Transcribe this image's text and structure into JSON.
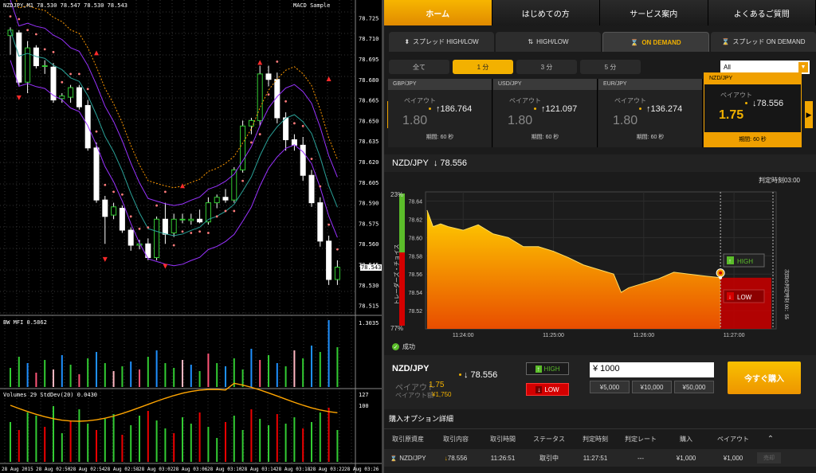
{
  "mt4": {
    "title": "NZDJPY,M1  78.530 78.547 78.530 78.543",
    "indicator_label": "MACD Sample",
    "current_price_tag": "78.543",
    "price_axis": [
      "78.725",
      "78.710",
      "78.695",
      "78.680",
      "78.665",
      "78.650",
      "78.635",
      "78.620",
      "78.605",
      "78.590",
      "78.575",
      "78.560",
      "78.545",
      "78.530",
      "78.515"
    ],
    "mfi_label": "BW MFI 0.5862",
    "mfi_axis": [
      "1.3035",
      "0"
    ],
    "volume_label": "Volumes 29  StdDev(20) 0.0430",
    "volume_axis": [
      "127",
      "100",
      "0"
    ],
    "time_axis": [
      "28 Aug 2015",
      "28 Aug 02:50",
      "28 Aug 02:54",
      "28 Aug 02:58",
      "28 Aug 03:02",
      "28 Aug 03:06",
      "28 Aug 03:10",
      "28 Aug 03:14",
      "28 Aug 03:18",
      "28 Aug 03:22",
      "28 Aug 03:26"
    ],
    "candles": [
      {
        "o": 78.712,
        "h": 78.718,
        "l": 78.698,
        "c": 78.716
      },
      {
        "o": 78.714,
        "h": 78.716,
        "l": 78.675,
        "c": 78.678
      },
      {
        "o": 78.678,
        "h": 78.708,
        "l": 78.67,
        "c": 78.703
      },
      {
        "o": 78.703,
        "h": 78.705,
        "l": 78.688,
        "c": 78.69
      },
      {
        "o": 78.69,
        "h": 78.694,
        "l": 78.684,
        "c": 78.69
      },
      {
        "o": 78.689,
        "h": 78.692,
        "l": 78.663,
        "c": 78.665
      },
      {
        "o": 78.666,
        "h": 78.67,
        "l": 78.663,
        "c": 78.668
      },
      {
        "o": 78.667,
        "h": 78.676,
        "l": 78.663,
        "c": 78.674
      },
      {
        "o": 78.674,
        "h": 78.676,
        "l": 78.658,
        "c": 78.66
      },
      {
        "o": 78.661,
        "h": 78.665,
        "l": 78.628,
        "c": 78.63
      },
      {
        "o": 78.63,
        "h": 78.634,
        "l": 78.59,
        "c": 78.592
      },
      {
        "o": 78.592,
        "h": 78.595,
        "l": 78.56,
        "c": 78.58
      },
      {
        "o": 78.581,
        "h": 78.59,
        "l": 78.578,
        "c": 78.587
      },
      {
        "o": 78.586,
        "h": 78.588,
        "l": 78.568,
        "c": 78.57
      },
      {
        "o": 78.57,
        "h": 78.572,
        "l": 78.555,
        "c": 78.559
      },
      {
        "o": 78.559,
        "h": 78.563,
        "l": 78.556,
        "c": 78.56
      },
      {
        "o": 78.56,
        "h": 78.564,
        "l": 78.548,
        "c": 78.55
      },
      {
        "o": 78.55,
        "h": 78.58,
        "l": 78.548,
        "c": 78.578
      },
      {
        "o": 78.578,
        "h": 78.59,
        "l": 78.56,
        "c": 78.567
      },
      {
        "o": 78.568,
        "h": 78.582,
        "l": 78.565,
        "c": 78.578
      },
      {
        "o": 78.578,
        "h": 78.582,
        "l": 78.575,
        "c": 78.578
      },
      {
        "o": 78.577,
        "h": 78.582,
        "l": 78.574,
        "c": 78.578
      },
      {
        "o": 78.578,
        "h": 78.585,
        "l": 78.575,
        "c": 78.576
      },
      {
        "o": 78.576,
        "h": 78.594,
        "l": 78.574,
        "c": 78.59
      },
      {
        "o": 78.59,
        "h": 78.596,
        "l": 78.586,
        "c": 78.594
      },
      {
        "o": 78.594,
        "h": 78.6,
        "l": 78.59,
        "c": 78.592
      },
      {
        "o": 78.592,
        "h": 78.616,
        "l": 78.59,
        "c": 78.614
      },
      {
        "o": 78.614,
        "h": 78.65,
        "l": 78.612,
        "c": 78.646
      },
      {
        "o": 78.646,
        "h": 78.652,
        "l": 78.64,
        "c": 78.65
      },
      {
        "o": 78.65,
        "h": 78.69,
        "l": 78.646,
        "c": 78.684
      },
      {
        "o": 78.684,
        "h": 78.69,
        "l": 78.675,
        "c": 78.68
      },
      {
        "o": 78.68,
        "h": 78.685,
        "l": 78.648,
        "c": 78.652
      },
      {
        "o": 78.652,
        "h": 78.656,
        "l": 78.628,
        "c": 78.636
      },
      {
        "o": 78.636,
        "h": 78.64,
        "l": 78.628,
        "c": 78.632
      },
      {
        "o": 78.632,
        "h": 78.638,
        "l": 78.606,
        "c": 78.61
      },
      {
        "o": 78.61,
        "h": 78.614,
        "l": 78.587,
        "c": 78.59
      },
      {
        "o": 78.59,
        "h": 78.594,
        "l": 78.558,
        "c": 78.562
      },
      {
        "o": 78.562,
        "h": 78.566,
        "l": 78.53,
        "c": 78.534
      },
      {
        "o": 78.534,
        "h": 78.548,
        "l": 78.53,
        "c": 78.543
      }
    ]
  },
  "top_tabs": [
    "ホーム",
    "はじめての方",
    "サービス案内",
    "よくあるご質問"
  ],
  "sub_tabs": [
    {
      "icon": "spread-arrows-icon",
      "label": "スプレッド HIGH/LOW"
    },
    {
      "icon": "updown-arrows-icon",
      "label": "HIGH/LOW"
    },
    {
      "icon": "hourglass-icon",
      "label": "ON DEMAND"
    },
    {
      "icon": "hourglass-icon",
      "label": "スプレッド ON DEMAND"
    }
  ],
  "durations": [
    "全て",
    "1 分",
    "3 分",
    "5 分"
  ],
  "filter": {
    "value": "All"
  },
  "pairs": [
    {
      "name": "GBP/JPY",
      "payout_label": "ペイアウト",
      "payout": "1.80",
      "rate": "↑186.764",
      "period": "期間: 60 秒"
    },
    {
      "name": "USD/JPY",
      "payout_label": "ペイアウト",
      "payout": "1.80",
      "rate": "↑121.097",
      "period": "期間: 60 秒"
    },
    {
      "name": "EUR/JPY",
      "payout_label": "ペイアウト",
      "payout": "1.80",
      "rate": "↑136.274",
      "period": "期間: 60 秒"
    },
    {
      "name": "NZD/JPY",
      "payout_label": "ペイアウト",
      "payout": "1.75",
      "rate": "↓78.556",
      "period": "期間: 60 秒"
    }
  ],
  "main": {
    "pair": "NZD/JPY",
    "rate": "↓ 78.556",
    "expiry": "判定時刻03:00",
    "trader_choice": "トレーダーズ・チョイス",
    "pct_high": "23%",
    "pct_low": "77%",
    "vertical_note": "次回の判定時刻 00：55",
    "high_label": "HIGH",
    "low_label": "LOW"
  },
  "chart_data": {
    "type": "area",
    "ylim": [
      78.5,
      78.65
    ],
    "yticks": [
      "78.64",
      "78.62",
      "78.60",
      "78.58",
      "78.56",
      "78.54",
      "78.52"
    ],
    "xticks": [
      "11:24:00",
      "11:25:00",
      "11:26:00",
      "11:27:00"
    ],
    "x": [
      "11:23:36",
      "11:23:40",
      "11:23:45",
      "11:23:50",
      "11:24:00",
      "11:24:10",
      "11:24:20",
      "11:24:30",
      "11:24:40",
      "11:24:50",
      "11:25:00",
      "11:25:10",
      "11:25:20",
      "11:25:30",
      "11:25:40",
      "11:25:45",
      "11:25:50",
      "11:26:00",
      "11:26:10",
      "11:26:20",
      "11:26:30",
      "11:26:40",
      "11:26:51"
    ],
    "values": [
      78.63,
      78.612,
      78.615,
      78.612,
      78.608,
      78.614,
      78.604,
      78.6,
      78.59,
      78.59,
      78.585,
      78.578,
      78.57,
      78.565,
      78.56,
      78.54,
      78.545,
      78.55,
      78.555,
      78.562,
      78.56,
      78.558,
      78.556
    ],
    "strike": "78.556",
    "strike_time": "11:26:51"
  },
  "status_text": "成功",
  "trade_panel": {
    "pair": "NZD/JPY",
    "rate": "↓ 78.556",
    "payout_label": "ペイアウト",
    "payout": "1.75",
    "amount_label": "ペイアウト額",
    "amount": "¥1,750",
    "high": "HIGH",
    "low": "LOW",
    "invest": "¥ 1000",
    "quick": [
      "¥5,000",
      "¥10,000",
      "¥50,000"
    ],
    "buy": "今すぐ購入"
  },
  "details": {
    "title": "購入オプション詳細",
    "headers": [
      "取引原資産",
      "取引内容",
      "取引時間",
      "ステータス",
      "判定時刻",
      "判定レート",
      "購入",
      "ペイアウト"
    ],
    "row": [
      "NZD/JPY",
      "78.556",
      "11:26:51",
      "取引中",
      "11:27:51",
      "---",
      "¥1,000",
      "¥1,000"
    ],
    "row_btn": "売却"
  },
  "colors": {
    "accent": "#f0a000",
    "high": "#5bbd2a",
    "low": "#d40000",
    "area_top": "#ffcc00",
    "area_bottom": "#e84d00"
  }
}
